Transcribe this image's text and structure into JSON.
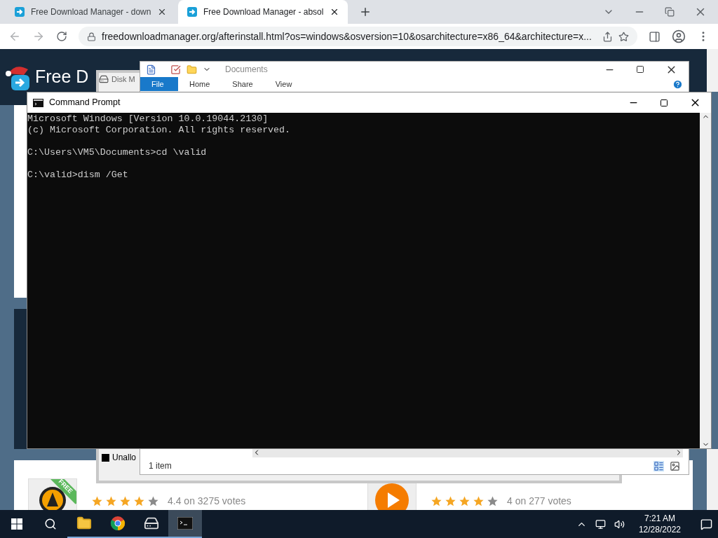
{
  "browser": {
    "tabs": [
      {
        "title": "Free Download Manager - down",
        "selected": false
      },
      {
        "title": "Free Download Manager - absol",
        "selected": true
      }
    ],
    "address": "freedownloadmanager.org/afterinstall.html?os=windows&osversion=10&osarchitecture=x86_64&architecture=x...",
    "page": {
      "logo_text": "Free D",
      "apps": [
        {
          "badge": "FREE",
          "stars": 4,
          "rating": "4.4 on 3275 votes"
        },
        {
          "stars": 4,
          "rating": "4 on 277 votes"
        }
      ]
    }
  },
  "disk_management": {
    "title": "Disk M",
    "volume_label": "Unallo"
  },
  "explorer": {
    "title": "Documents",
    "ribbon_tabs": [
      {
        "label": "File",
        "selected": true
      },
      {
        "label": "Home",
        "selected": false
      },
      {
        "label": "Share",
        "selected": false
      },
      {
        "label": "View",
        "selected": false
      }
    ],
    "status": "1 item"
  },
  "command_prompt": {
    "title": "Command Prompt",
    "paragraphs": [
      [
        "Microsoft Windows [Version 10.0.19044.2130]",
        "(c) Microsoft Corporation. All rights reserved."
      ],
      [
        "C:\\Users\\VM5\\Documents>cd \\valid"
      ],
      [
        "C:\\valid>dism /Get"
      ]
    ]
  },
  "taskbar": {
    "apps": [
      {
        "kind": "explorer",
        "active": false
      },
      {
        "kind": "chrome",
        "active": false
      },
      {
        "kind": "disk",
        "active": false
      },
      {
        "kind": "terminal",
        "active": true
      }
    ],
    "time": "7:21 AM",
    "date": "12/28/2022"
  }
}
